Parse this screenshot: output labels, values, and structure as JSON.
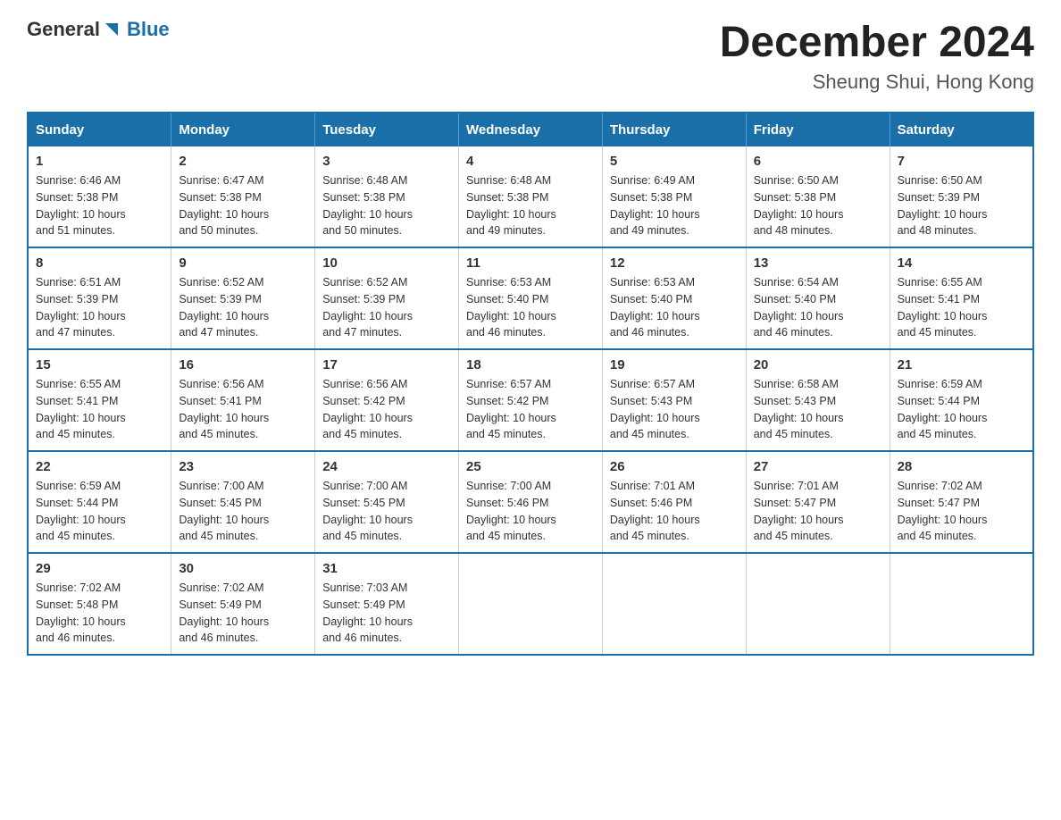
{
  "logo": {
    "text_general": "General",
    "text_blue": "Blue"
  },
  "title": "December 2024",
  "location": "Sheung Shui, Hong Kong",
  "days_of_week": [
    "Sunday",
    "Monday",
    "Tuesday",
    "Wednesday",
    "Thursday",
    "Friday",
    "Saturday"
  ],
  "weeks": [
    [
      {
        "day": "1",
        "sunrise": "6:46 AM",
        "sunset": "5:38 PM",
        "daylight": "10 hours and 51 minutes."
      },
      {
        "day": "2",
        "sunrise": "6:47 AM",
        "sunset": "5:38 PM",
        "daylight": "10 hours and 50 minutes."
      },
      {
        "day": "3",
        "sunrise": "6:48 AM",
        "sunset": "5:38 PM",
        "daylight": "10 hours and 50 minutes."
      },
      {
        "day": "4",
        "sunrise": "6:48 AM",
        "sunset": "5:38 PM",
        "daylight": "10 hours and 49 minutes."
      },
      {
        "day": "5",
        "sunrise": "6:49 AM",
        "sunset": "5:38 PM",
        "daylight": "10 hours and 49 minutes."
      },
      {
        "day": "6",
        "sunrise": "6:50 AM",
        "sunset": "5:38 PM",
        "daylight": "10 hours and 48 minutes."
      },
      {
        "day": "7",
        "sunrise": "6:50 AM",
        "sunset": "5:39 PM",
        "daylight": "10 hours and 48 minutes."
      }
    ],
    [
      {
        "day": "8",
        "sunrise": "6:51 AM",
        "sunset": "5:39 PM",
        "daylight": "10 hours and 47 minutes."
      },
      {
        "day": "9",
        "sunrise": "6:52 AM",
        "sunset": "5:39 PM",
        "daylight": "10 hours and 47 minutes."
      },
      {
        "day": "10",
        "sunrise": "6:52 AM",
        "sunset": "5:39 PM",
        "daylight": "10 hours and 47 minutes."
      },
      {
        "day": "11",
        "sunrise": "6:53 AM",
        "sunset": "5:40 PM",
        "daylight": "10 hours and 46 minutes."
      },
      {
        "day": "12",
        "sunrise": "6:53 AM",
        "sunset": "5:40 PM",
        "daylight": "10 hours and 46 minutes."
      },
      {
        "day": "13",
        "sunrise": "6:54 AM",
        "sunset": "5:40 PM",
        "daylight": "10 hours and 46 minutes."
      },
      {
        "day": "14",
        "sunrise": "6:55 AM",
        "sunset": "5:41 PM",
        "daylight": "10 hours and 45 minutes."
      }
    ],
    [
      {
        "day": "15",
        "sunrise": "6:55 AM",
        "sunset": "5:41 PM",
        "daylight": "10 hours and 45 minutes."
      },
      {
        "day": "16",
        "sunrise": "6:56 AM",
        "sunset": "5:41 PM",
        "daylight": "10 hours and 45 minutes."
      },
      {
        "day": "17",
        "sunrise": "6:56 AM",
        "sunset": "5:42 PM",
        "daylight": "10 hours and 45 minutes."
      },
      {
        "day": "18",
        "sunrise": "6:57 AM",
        "sunset": "5:42 PM",
        "daylight": "10 hours and 45 minutes."
      },
      {
        "day": "19",
        "sunrise": "6:57 AM",
        "sunset": "5:43 PM",
        "daylight": "10 hours and 45 minutes."
      },
      {
        "day": "20",
        "sunrise": "6:58 AM",
        "sunset": "5:43 PM",
        "daylight": "10 hours and 45 minutes."
      },
      {
        "day": "21",
        "sunrise": "6:59 AM",
        "sunset": "5:44 PM",
        "daylight": "10 hours and 45 minutes."
      }
    ],
    [
      {
        "day": "22",
        "sunrise": "6:59 AM",
        "sunset": "5:44 PM",
        "daylight": "10 hours and 45 minutes."
      },
      {
        "day": "23",
        "sunrise": "7:00 AM",
        "sunset": "5:45 PM",
        "daylight": "10 hours and 45 minutes."
      },
      {
        "day": "24",
        "sunrise": "7:00 AM",
        "sunset": "5:45 PM",
        "daylight": "10 hours and 45 minutes."
      },
      {
        "day": "25",
        "sunrise": "7:00 AM",
        "sunset": "5:46 PM",
        "daylight": "10 hours and 45 minutes."
      },
      {
        "day": "26",
        "sunrise": "7:01 AM",
        "sunset": "5:46 PM",
        "daylight": "10 hours and 45 minutes."
      },
      {
        "day": "27",
        "sunrise": "7:01 AM",
        "sunset": "5:47 PM",
        "daylight": "10 hours and 45 minutes."
      },
      {
        "day": "28",
        "sunrise": "7:02 AM",
        "sunset": "5:47 PM",
        "daylight": "10 hours and 45 minutes."
      }
    ],
    [
      {
        "day": "29",
        "sunrise": "7:02 AM",
        "sunset": "5:48 PM",
        "daylight": "10 hours and 46 minutes."
      },
      {
        "day": "30",
        "sunrise": "7:02 AM",
        "sunset": "5:49 PM",
        "daylight": "10 hours and 46 minutes."
      },
      {
        "day": "31",
        "sunrise": "7:03 AM",
        "sunset": "5:49 PM",
        "daylight": "10 hours and 46 minutes."
      },
      null,
      null,
      null,
      null
    ]
  ],
  "labels": {
    "sunrise": "Sunrise:",
    "sunset": "Sunset:",
    "daylight": "Daylight:"
  }
}
